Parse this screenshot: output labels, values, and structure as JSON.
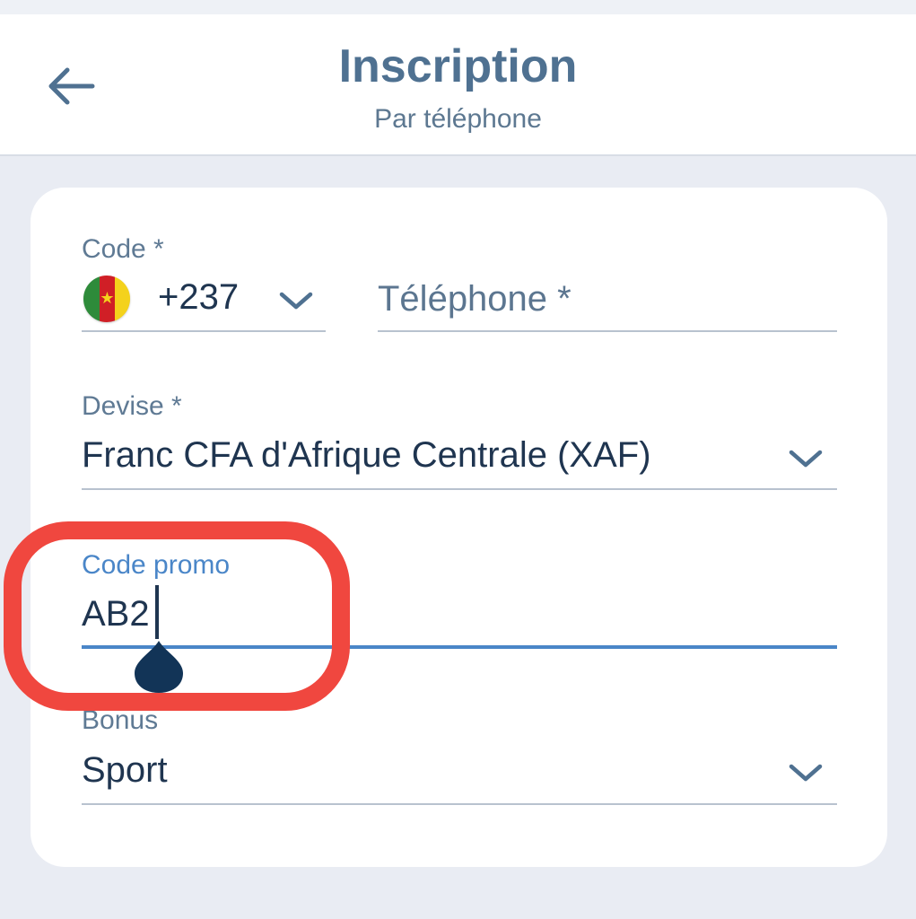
{
  "header": {
    "title": "Inscription",
    "subtitle": "Par téléphone",
    "back_icon": "arrow-left-icon"
  },
  "form": {
    "country_code": {
      "label": "Code *",
      "flag_icon": "cameroon-flag-icon",
      "value": "+237"
    },
    "phone": {
      "placeholder": "Téléphone *",
      "value": ""
    },
    "currency": {
      "label": "Devise *",
      "value": "Franc CFA d'Afrique Centrale (XAF)"
    },
    "promo_code": {
      "label": "Code promo",
      "value": "AB2"
    },
    "bonus": {
      "label": "Bonus",
      "value": "Sport"
    }
  },
  "colors": {
    "accent": "#4f7191",
    "focus_line": "#4a86c8",
    "annotation": "#f0473f"
  }
}
